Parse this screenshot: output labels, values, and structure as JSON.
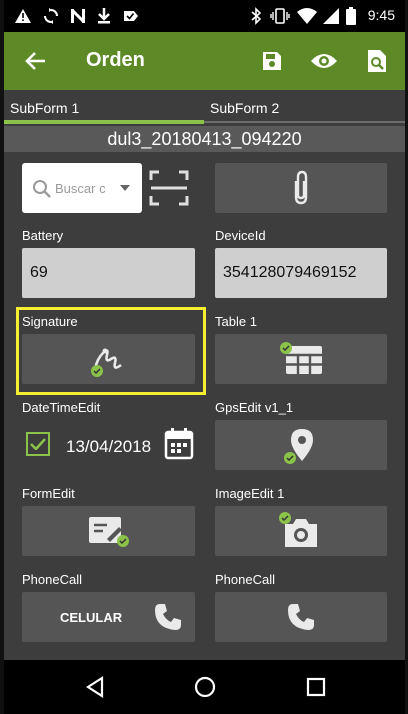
{
  "status_bar": {
    "time": "9:45",
    "icons": [
      "warning-icon",
      "sync-icon",
      "notifications-off-icon",
      "download-icon",
      "task-icon",
      "bluetooth-icon",
      "vibrate-icon",
      "wifi-icon",
      "signal-icon",
      "battery-icon"
    ]
  },
  "app_bar": {
    "title": "Orden",
    "back_icon": "back-arrow-icon",
    "actions": [
      "save-icon",
      "preview-icon",
      "search-doc-icon"
    ]
  },
  "tabs": [
    {
      "label": "SubForm 1",
      "selected": true
    },
    {
      "label": "SubForm 2",
      "selected": false
    }
  ],
  "form_name": "dul3_20180413_094220",
  "fields": {
    "search": {
      "placeholder": "Buscar c"
    },
    "battery": {
      "label": "Battery",
      "value": "69"
    },
    "device_id": {
      "label": "DeviceId",
      "value": "354128079469152"
    },
    "signature": {
      "label": "Signature"
    },
    "table": {
      "label": "Table 1"
    },
    "datetime": {
      "label": "DateTimeEdit",
      "value": "13/04/2018",
      "checked": true
    },
    "gps": {
      "label": "GpsEdit v1_1"
    },
    "form_edit": {
      "label": "FormEdit"
    },
    "image_edit": {
      "label": "ImageEdit 1"
    },
    "phone_call_1": {
      "label": "PhoneCall",
      "button_text": "CELULAR"
    },
    "phone_call_2": {
      "label": "PhoneCall"
    }
  },
  "colors": {
    "app_bar": "#5d8a27",
    "accent": "#8bc34a",
    "highlight": "#f4f031"
  }
}
